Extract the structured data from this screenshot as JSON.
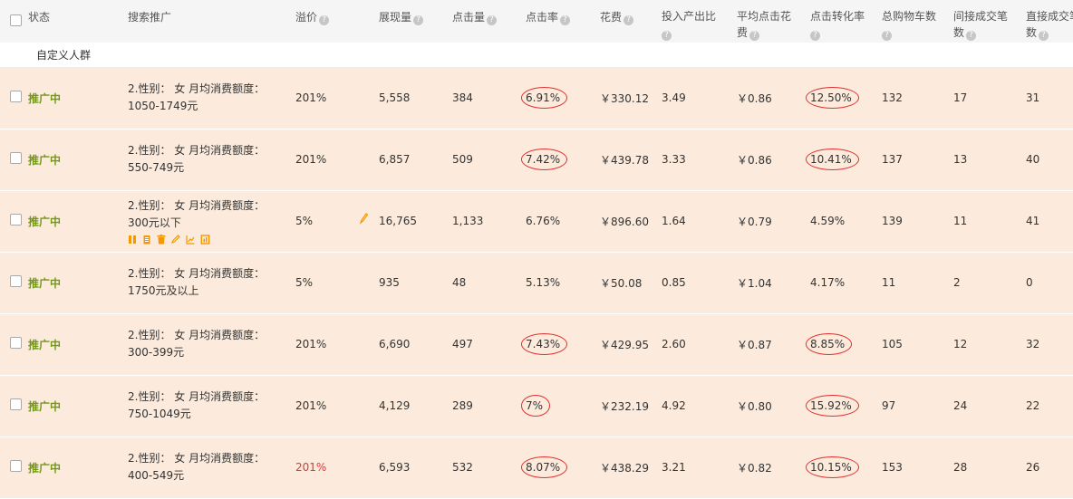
{
  "columns": {
    "status": "状态",
    "crowd": "搜索推广",
    "premium": "溢价",
    "impressions": "展现量",
    "clicks": "点击量",
    "ctr": "点击率",
    "cost": "花费",
    "roi": "投入产出比",
    "cpc": "平均点击花费",
    "cvr": "点击转化率",
    "cart": "总购物车数",
    "indirect": "间接成交笔数",
    "direct": "直接成交笔数"
  },
  "help_icon": "?",
  "group_label": "自定义人群",
  "rows": [
    {
      "status": "推广中",
      "crowd_line1": "2.性别： 女 月均消费额度：",
      "crowd_line2": "1050-1749元",
      "premium": "201%",
      "impressions": "5,558",
      "clicks": "384",
      "ctr": "6.91%",
      "cost": "￥330.12",
      "roi": "3.49",
      "cpc": "￥0.86",
      "cvr": "12.50%",
      "cart": "132",
      "indirect": "17",
      "direct": "31"
    },
    {
      "status": "推广中",
      "crowd_line1": "2.性别： 女 月均消费额度：",
      "crowd_line2": "550-749元",
      "premium": "201%",
      "impressions": "6,857",
      "clicks": "509",
      "ctr": "7.42%",
      "cost": "￥439.78",
      "roi": "3.33",
      "cpc": "￥0.86",
      "cvr": "10.41%",
      "cart": "137",
      "indirect": "13",
      "direct": "40"
    },
    {
      "status": "推广中",
      "crowd_line1": "2.性别： 女 月均消费额度：",
      "crowd_line2": "300元以下",
      "premium": "5%",
      "impressions": "16,765",
      "clicks": "1,133",
      "ctr": "6.76%",
      "cost": "￥896.60",
      "roi": "1.64",
      "cpc": "￥0.79",
      "cvr": "4.59%",
      "cart": "139",
      "indirect": "11",
      "direct": "41"
    },
    {
      "status": "推广中",
      "crowd_line1": "2.性别： 女 月均消费额度：",
      "crowd_line2": "1750元及以上",
      "premium": "5%",
      "impressions": "935",
      "clicks": "48",
      "ctr": "5.13%",
      "cost": "￥50.08",
      "roi": "0.85",
      "cpc": "￥1.04",
      "cvr": "4.17%",
      "cart": "11",
      "indirect": "2",
      "direct": "0"
    },
    {
      "status": "推广中",
      "crowd_line1": "2.性别： 女 月均消费额度：",
      "crowd_line2": "300-399元",
      "premium": "201%",
      "impressions": "6,690",
      "clicks": "497",
      "ctr": "7.43%",
      "cost": "￥429.95",
      "roi": "2.60",
      "cpc": "￥0.87",
      "cvr": "8.85%",
      "cart": "105",
      "indirect": "12",
      "direct": "32"
    },
    {
      "status": "推广中",
      "crowd_line1": "2.性别： 女 月均消费额度：",
      "crowd_line2": "750-1049元",
      "premium": "201%",
      "impressions": "4,129",
      "clicks": "289",
      "ctr": "7%",
      "cost": "￥232.19",
      "roi": "4.92",
      "cpc": "￥0.80",
      "cvr": "15.92%",
      "cart": "97",
      "indirect": "24",
      "direct": "22"
    },
    {
      "status": "推广中",
      "crowd_line1": "2.性别： 女 月均消费额度：",
      "crowd_line2": "400-549元",
      "premium": "201%",
      "impressions": "6,593",
      "clicks": "532",
      "ctr": "8.07%",
      "cost": "￥438.29",
      "roi": "3.21",
      "cpc": "￥0.82",
      "cvr": "10.15%",
      "cart": "153",
      "indirect": "28",
      "direct": "26"
    }
  ],
  "colors": {
    "status": "#6f9b0f",
    "annotation": "#e0302f",
    "premium_highlight": "#d9383c",
    "row_bg": "#fcebdc",
    "action_icon": "#f39800"
  },
  "row_action_icons": [
    "pause-icon",
    "copy-icon",
    "delete-icon",
    "edit-icon",
    "trend-chart-icon",
    "report-icon"
  ]
}
